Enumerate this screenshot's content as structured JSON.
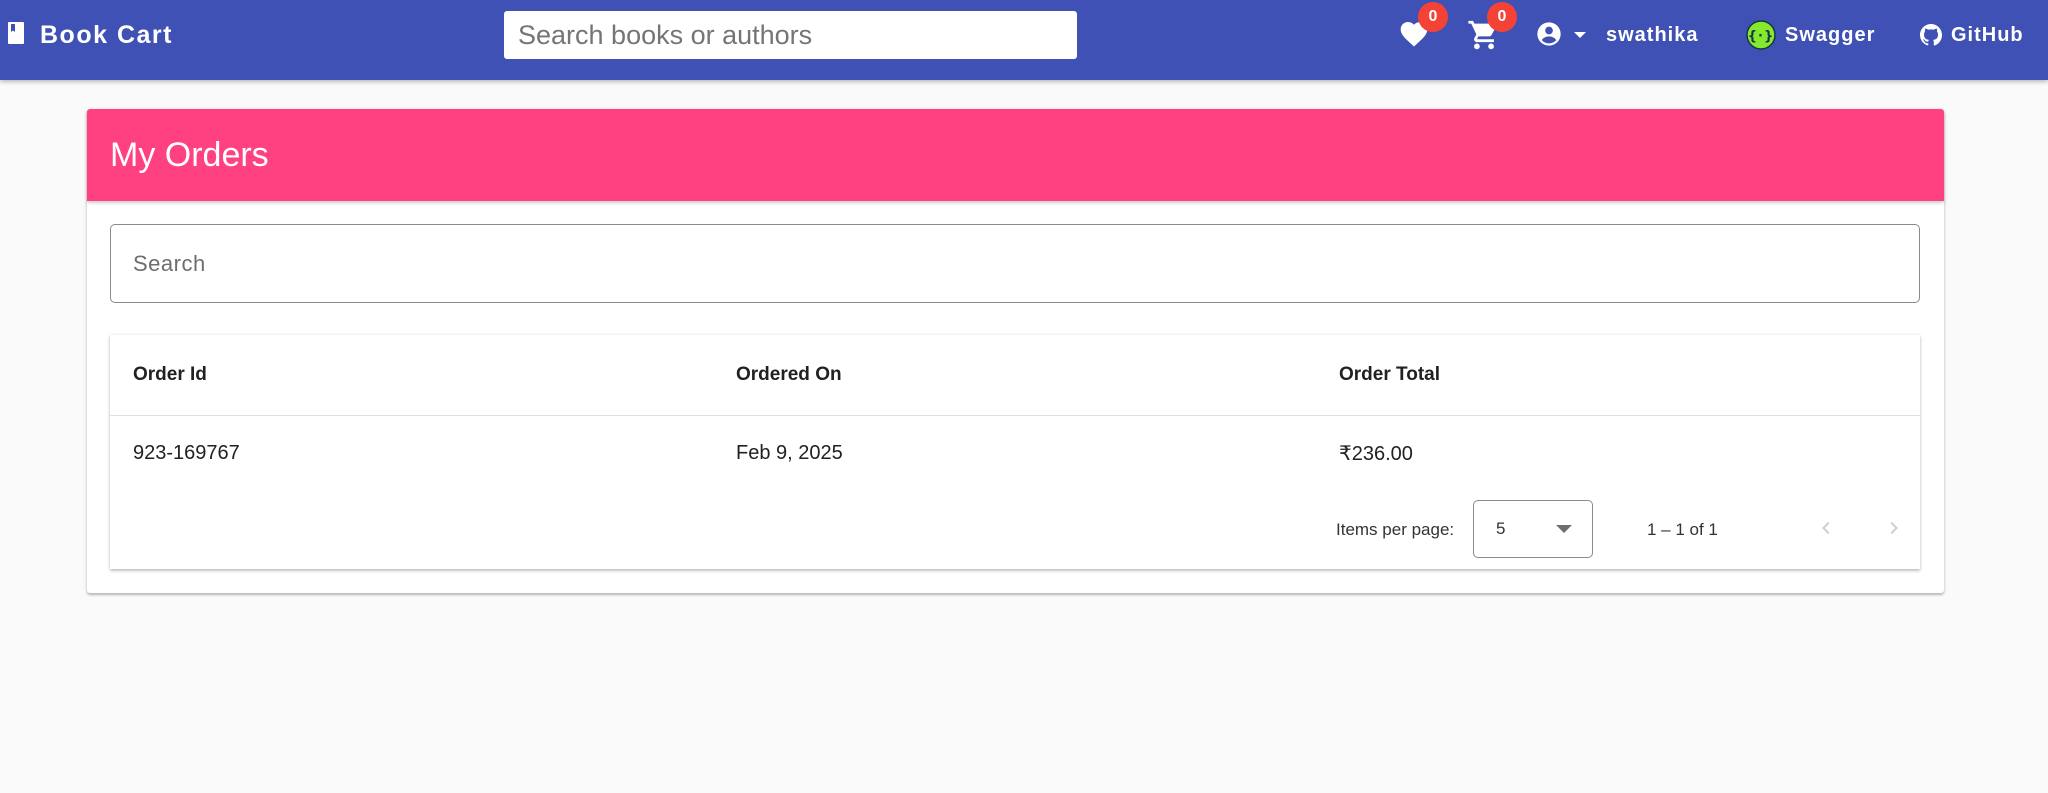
{
  "header": {
    "app_title": "Book Cart",
    "search_placeholder": "Search books or authors",
    "wishlist_count": "0",
    "cart_count": "0",
    "username": "swathika",
    "swagger_label": "Swagger",
    "github_label": "GitHub",
    "brand_icon": "book-icon",
    "colors": {
      "toolbar": "#3f51b5",
      "badge": "#f44336"
    }
  },
  "orders": {
    "title": "My Orders",
    "search_placeholder": "Search",
    "columns": [
      "Order Id",
      "Ordered On",
      "Order Total"
    ],
    "rows": [
      {
        "order_id": "923-169767",
        "ordered_on": "Feb 9, 2025",
        "order_total": "₹236.00"
      }
    ],
    "paginator": {
      "items_per_page_label": "Items per page:",
      "page_size": "5",
      "range_label": "1 – 1 of 1"
    },
    "colors": {
      "header": "#ff4081"
    }
  }
}
